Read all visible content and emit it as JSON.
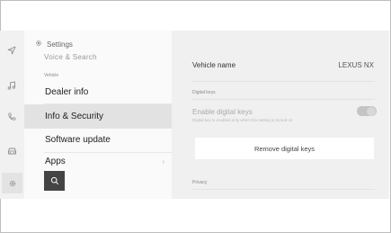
{
  "nav": {
    "icons": [
      "navigation-arrow-icon",
      "music-note-icon",
      "phone-icon",
      "car-icon",
      "gear-icon"
    ]
  },
  "settings_list": {
    "header": "Settings",
    "cut_off_item": "Voice & Search",
    "section_label": "Vehicle",
    "items": [
      {
        "label": "Dealer info"
      },
      {
        "label": "Info & Security",
        "selected": true
      },
      {
        "label": "Software update"
      },
      {
        "label": "Apps"
      }
    ]
  },
  "detail": {
    "vehicle_name_label": "Vehicle name",
    "vehicle_name_value": "LEXUS NX",
    "digital_keys_section": "Digital keys",
    "enable_digital_keys_label": "Enable digital keys",
    "enable_digital_keys_sub": "Digital key is enabled only when this setting is turned on",
    "enable_digital_keys_on": false,
    "remove_digital_keys_label": "Remove digital keys",
    "privacy_section": "Privacy"
  }
}
